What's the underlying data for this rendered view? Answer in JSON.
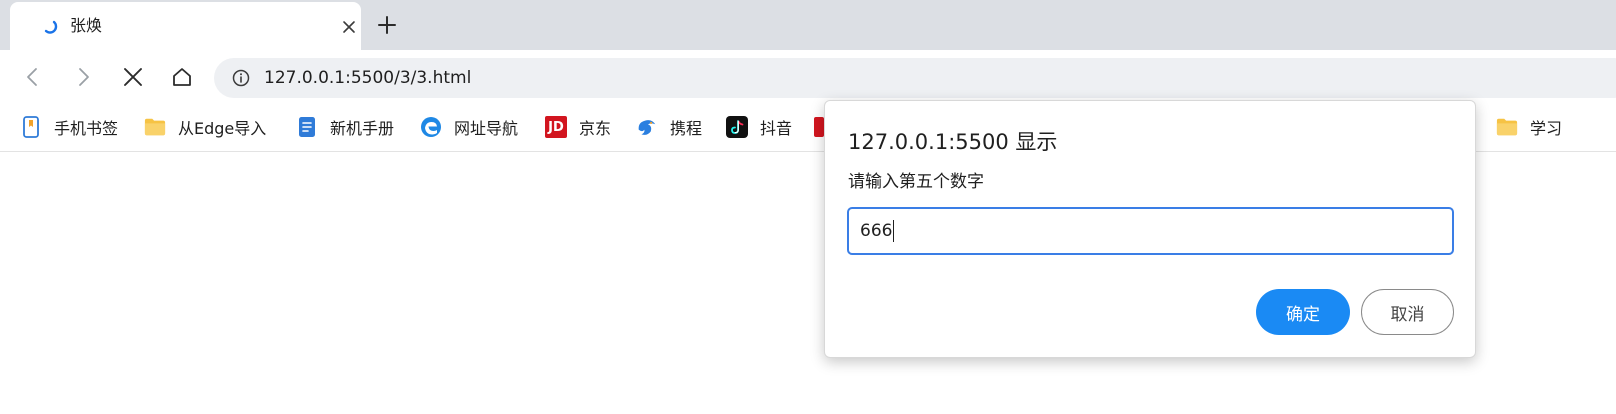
{
  "tab": {
    "title": "张焕",
    "loading_icon": "spinner-icon",
    "close_icon": "close-icon"
  },
  "new_tab_icon": "plus-icon",
  "toolbar": {
    "back_icon": "chevron-left-icon",
    "forward_icon": "chevron-right-icon",
    "stop_icon": "close-icon",
    "home_icon": "home-icon",
    "url": "127.0.0.1:5500/3/3.html"
  },
  "bookmarks": [
    {
      "label": "手机书签",
      "icon": "phone-bookmark-icon"
    },
    {
      "label": "从Edge导入",
      "icon": "folder-icon"
    },
    {
      "label": "新机手册",
      "icon": "manual-icon"
    },
    {
      "label": "网址导航",
      "icon": "edge-icon"
    },
    {
      "label": "京东",
      "icon": "jd-icon",
      "badge": "JD"
    },
    {
      "label": "携程",
      "icon": "ctrip-icon"
    },
    {
      "label": "抖音",
      "icon": "douyin-icon"
    },
    {
      "label": "学习",
      "icon": "folder-icon"
    }
  ],
  "dialog": {
    "title": "127.0.0.1:5500 显示",
    "message": "请输入第五个数字",
    "input_value": "666",
    "ok_label": "确定",
    "cancel_label": "取消"
  },
  "colors": {
    "accent": "#1a8af4",
    "input_border": "#3a7ee6",
    "tabstrip": "#dcdfe4",
    "omnibox": "#eef0f3",
    "folder": "#f6c344",
    "jd_red": "#d2151f"
  }
}
